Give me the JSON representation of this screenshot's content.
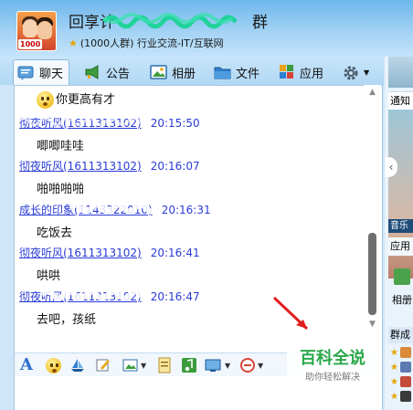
{
  "group": {
    "title_prefix": "回享计",
    "title_suffix": "群",
    "avatar_badge": "1000",
    "subline": "(1000人群) 行业交流-IT/互联网"
  },
  "tabs": [
    {
      "label": "聊天",
      "icon": "chat-icon"
    },
    {
      "label": "公告",
      "icon": "megaphone-icon"
    },
    {
      "label": "相册",
      "icon": "album-icon"
    },
    {
      "label": "文件",
      "icon": "folder-icon"
    },
    {
      "label": "应用",
      "icon": "apps-icon"
    },
    {
      "label": "",
      "icon": "gear-icon"
    }
  ],
  "messages": [
    {
      "name": "",
      "time": "",
      "text": "你更高有才",
      "has_emoji": true
    },
    {
      "name": "彻夜听风(1611313102)",
      "time": "20:15:50",
      "text": "唧唧哇哇"
    },
    {
      "name": "彻夜听风(1611313102)",
      "time": "20:16:07",
      "text": "啪啪啪啪"
    },
    {
      "name": "成长的印象(1143322010)",
      "time": "20:16:31",
      "text": "吃饭去"
    },
    {
      "name": "彻夜听风(1611313102)",
      "time": "20:16:41",
      "text": "哄哄"
    },
    {
      "name": "彻夜听风(1611313102)",
      "time": "20:16:47",
      "text": "去吧，孩纸"
    }
  ],
  "side": {
    "notice": "通知",
    "music": "音乐",
    "apps": "应用",
    "album": "相册",
    "members": "群成"
  },
  "toolbar": [
    {
      "icon": "font-icon"
    },
    {
      "icon": "emoji-icon"
    },
    {
      "icon": "ship-icon"
    },
    {
      "icon": "edit-icon"
    },
    {
      "icon": "image-icon"
    },
    {
      "icon": "note-icon"
    },
    {
      "icon": "music-note-icon"
    },
    {
      "icon": "screenshot-icon"
    },
    {
      "icon": "record-icon"
    }
  ],
  "watermark": {
    "title": "百科全说",
    "subtitle": "助你轻松解决"
  },
  "colors": {
    "name_link": "#2a3bd6",
    "header": "#8cc7f1",
    "accent_green": "#2aa84a"
  }
}
